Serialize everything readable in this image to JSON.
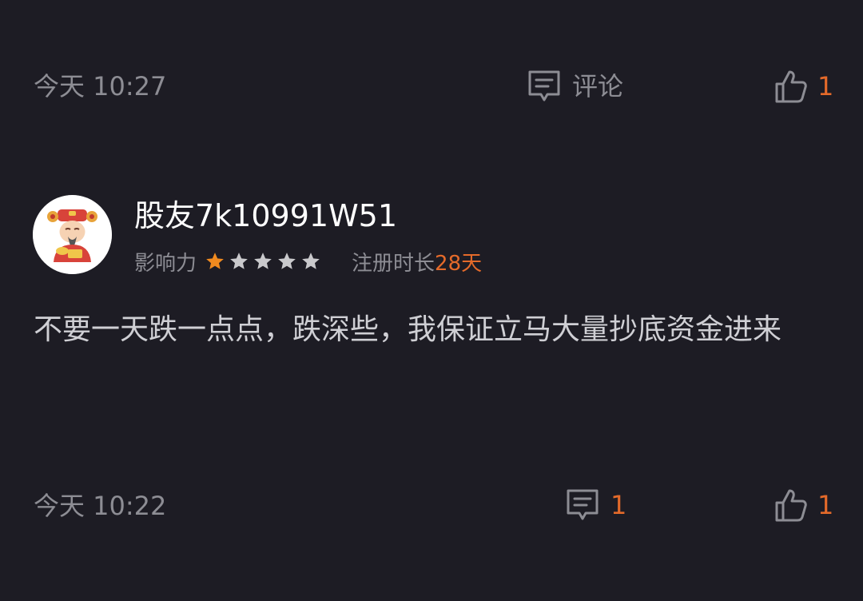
{
  "post_top": {
    "time": "今天 10:27",
    "comment_label": "评论",
    "like_count": "1",
    "comment_icon": "comment-icon",
    "like_icon": "thumbs-up-icon"
  },
  "comment": {
    "avatar_icon": "caishen-avatar",
    "username": "股友7k10991W51",
    "influence_label": "影响力",
    "influence_stars": 1,
    "influence_max": 5,
    "register_label": "注册时长",
    "register_value": "28天",
    "text": "不要一天跌一点点，跌深些，我保证立马大量抄底资金进来",
    "time": "今天 10:22",
    "comment_count": "1",
    "like_count": "1"
  },
  "colors": {
    "background": "#1d1c24",
    "accent": "#e46a2a",
    "muted": "#8d8d94",
    "star_active": "#f08a1f",
    "star_inactive": "#c9c9cc"
  }
}
